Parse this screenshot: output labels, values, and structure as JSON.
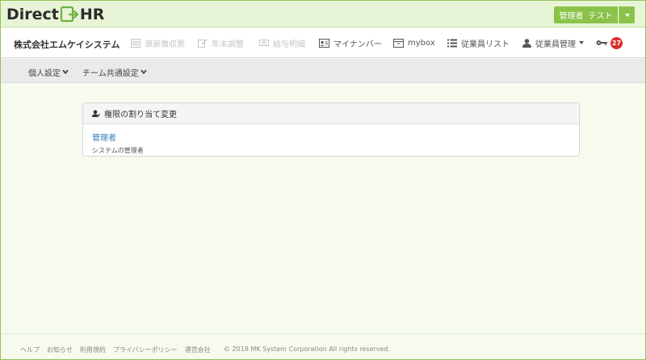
{
  "header": {
    "logo_left": "Direct",
    "logo_right": "HR",
    "user_role": "管理者",
    "user_name": "テスト"
  },
  "nav": {
    "company": "株式会社エムケイシステム",
    "items": [
      {
        "label": "源泉徴収票",
        "icon": "document-icon",
        "enabled": false
      },
      {
        "label": "年末調整",
        "icon": "edit-icon",
        "enabled": false
      },
      {
        "label": "給与明細",
        "icon": "money-icon",
        "enabled": false
      },
      {
        "label": "マイナンバー",
        "icon": "id-card-icon",
        "enabled": true
      },
      {
        "label": "mybox",
        "icon": "box-icon",
        "enabled": true
      },
      {
        "label": "従業員リスト",
        "icon": "list-icon",
        "enabled": true
      },
      {
        "label": "従業員管理",
        "icon": "user-icon",
        "enabled": true
      }
    ],
    "notification_count": "27"
  },
  "subnav": {
    "items": [
      {
        "label": "個人設定"
      },
      {
        "label": "チーム共通設定"
      }
    ]
  },
  "panel": {
    "title": "権限の割り当て変更",
    "role_name": "管理者",
    "role_description": "システムの管理者"
  },
  "footer": {
    "links": [
      "ヘルプ",
      "お知らせ",
      "利用規約",
      "プライバシーポリシー",
      "運営会社"
    ],
    "copyright": "© 2018 MK System Corporation All rights reserved."
  },
  "colors": {
    "accent": "#8bc34a",
    "header_bg": "#e8f4d6",
    "page_bg": "#f6fbee",
    "badge": "#d9302d",
    "link": "#3a7bbf"
  }
}
